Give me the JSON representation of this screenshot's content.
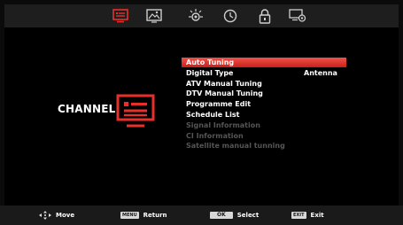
{
  "tabs": [
    {
      "name": "channel",
      "icon": "tv-list-icon",
      "active": true
    },
    {
      "name": "picture",
      "icon": "picture-icon",
      "active": false
    },
    {
      "name": "sound",
      "icon": "sound-icon",
      "active": false
    },
    {
      "name": "time",
      "icon": "clock-icon",
      "active": false
    },
    {
      "name": "lock",
      "icon": "padlock-icon",
      "active": false
    },
    {
      "name": "setup",
      "icon": "settings-icon",
      "active": false
    }
  ],
  "panel": {
    "title": "CHANNEL"
  },
  "menu": {
    "items": [
      {
        "label": "Auto Tuning",
        "state": "selected"
      },
      {
        "label": "Digital Type",
        "value": "Antenna",
        "state": "normal"
      },
      {
        "label": "ATV Manual Tuning",
        "state": "normal"
      },
      {
        "label": "DTV Manual Tuning",
        "state": "normal"
      },
      {
        "label": "Programme Edit",
        "state": "normal"
      },
      {
        "label": "Schedule List",
        "state": "normal"
      },
      {
        "label": "Signal Information",
        "state": "disabled"
      },
      {
        "label": "CI Information",
        "state": "disabled"
      },
      {
        "label": "Satellite manual tunning",
        "state": "disabled"
      }
    ]
  },
  "footer": {
    "move": {
      "label": "Move"
    },
    "return": {
      "key": "MENU",
      "label": "Return"
    },
    "select": {
      "key": "OK",
      "label": "Select"
    },
    "exit": {
      "key": "EXIT",
      "label": "Exit"
    }
  },
  "colors": {
    "accent": "#e8302a",
    "icon_gray": "#cfcfcf",
    "disabled_text": "#555555",
    "background": "#000000"
  }
}
